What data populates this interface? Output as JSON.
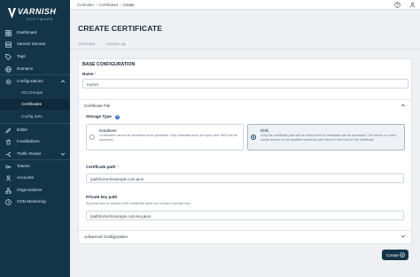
{
  "brand": {
    "name": "VARNISH",
    "sub": "SOFTWARE"
  },
  "sidebar": {
    "items": [
      {
        "label": "Dashboard",
        "icon": "dashboard-icon"
      },
      {
        "label": "Varnish Servers",
        "icon": "server-icon"
      },
      {
        "label": "Tags",
        "icon": "tag-icon"
      },
      {
        "label": "Domains",
        "icon": "domain-icon"
      },
      {
        "label": "Configurations",
        "icon": "configuration-icon"
      },
      {
        "label": "Editor",
        "icon": "editor-icon"
      },
      {
        "label": "Invalidations",
        "icon": "invalidation-icon"
      },
      {
        "label": "Traffic Router",
        "icon": "traffic-router-icon"
      },
      {
        "label": "Tokens",
        "icon": "token-icon"
      },
      {
        "label": "Accounts",
        "icon": "account-icon"
      },
      {
        "label": "Organizations",
        "icon": "organization-icon"
      },
      {
        "label": "CDN Monitoring",
        "icon": "cdn-monitoring-icon"
      }
    ],
    "sub_items": [
      {
        "label": "VCLGroups",
        "active": false
      },
      {
        "label": "Certificates",
        "active": true
      },
      {
        "label": "Config Sets",
        "active": false
      }
    ]
  },
  "breadcrumb": {
    "items": [
      "Controller",
      "Certificates",
      "Create"
    ]
  },
  "header": {
    "title": "CREATE CERTIFICATE"
  },
  "tabs": [
    {
      "label": "Overview"
    },
    {
      "label": "Activity Log"
    }
  ],
  "form": {
    "section_title": "BASE CONFIGURATION",
    "name": {
      "label": "Name",
      "required": "*",
      "value": "mycert"
    },
    "certificate_file": {
      "label": "Certificate File"
    },
    "storage_type": {
      "label": "Storage Type",
      "options": [
        {
          "title": "Database",
          "description": "Certificates cannot be accessed once uploaded. Only metadata such as expiry and SAN can be accessed.",
          "selected": false
        },
        {
          "title": "Disk",
          "description": "Only the certificate path will be stored and no metadata can be accessed. The server or router needs access to the specified absolute path where it will look for the certificate.",
          "selected": true
        }
      ]
    },
    "certificate_path": {
      "label": "Certificate path",
      "required": "*",
      "value": "/path/to/cert/example.com.pem"
    },
    "private_key_path": {
      "label": "Private key path",
      "help": "A private key is needed if the certificate does not contain a private key.",
      "value": "/path/to/cert/example.com-key.pem"
    },
    "advanced": {
      "label": "Advanced Configuration"
    }
  },
  "actions": {
    "create_label": "Create"
  },
  "colors": {
    "sidebar_bg": "#143547",
    "primary": "#143547",
    "page_bg": "#eef0f3",
    "info": "#3a74c4"
  }
}
